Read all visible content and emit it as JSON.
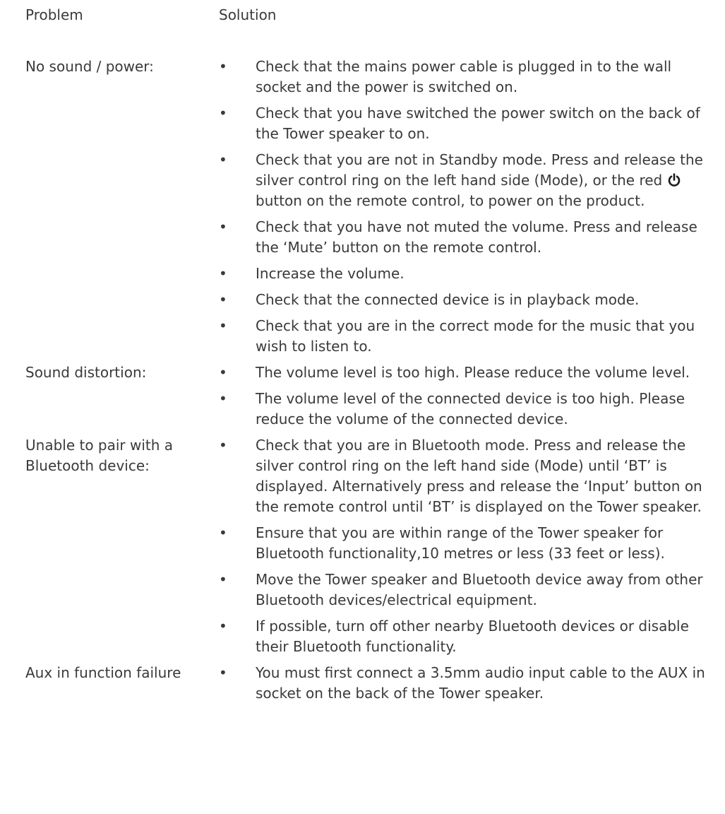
{
  "header": {
    "problem": "Problem",
    "solution": "Solution"
  },
  "rows": [
    {
      "problem": "No sound / power:",
      "solutions": [
        "Check that the mains power cable is plugged in to the wall socket and the power is switched on.",
        "Check that you have switched the power switch on the back of the Tower speaker to on.",
        "Check that you are not in Standby mode.  Press and release the silver control ring on the left hand side (Mode), or the red",
        "Check that you have not muted the volume.  Press and release the ‘Mute’ button on the remote control.",
        "Increase the volume.",
        "Check that the connected device is in playback mode.",
        "Check that you are in the correct mode for the music that you wish to listen to."
      ],
      "standby_continuation": "button on the remote control, to power on the product.",
      "standby_icon": "power-icon"
    },
    {
      "problem": "Sound distortion:",
      "solutions": [
        "The volume level is too high.  Please reduce the volume level.",
        "The volume level of the connected device is too high. Please reduce the volume of the connected device."
      ]
    },
    {
      "problem": "Unable to pair with a Bluetooth device:",
      "solutions": [
        "Check that you are in Bluetooth mode.  Press and release the silver control ring on the left hand side (Mode) until ‘BT’ is displayed. Alternatively press and release the ‘Input’ button on the remote control until ‘BT’ is displayed on the Tower speaker.",
        "Ensure that you are within range of the Tower speaker for Bluetooth functionality,10 metres or less (33 feet or less).",
        "Move the Tower speaker and Bluetooth device away from other Bluetooth devices/electrical equipment.",
        "If possible, turn off other nearby Bluetooth devices or disable their Bluetooth functionality."
      ]
    },
    {
      "problem": "Aux in function failure",
      "solutions": [
        "You must first connect a 3.5mm audio input cable to the AUX in socket on the back of the Tower speaker."
      ]
    }
  ],
  "bullet_char": "•"
}
